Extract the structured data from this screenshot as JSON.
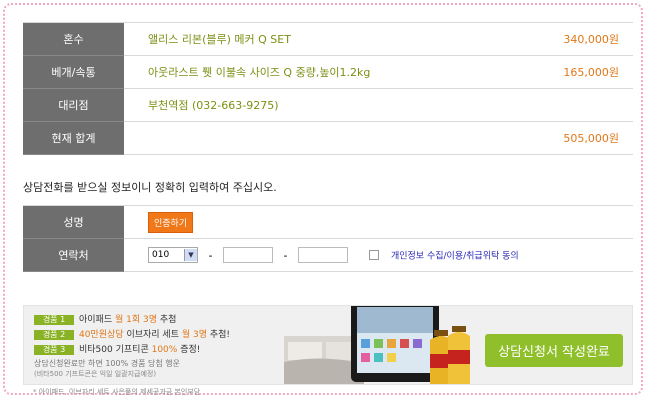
{
  "summary": [
    {
      "label": "혼수",
      "value": "앨리스 리본(블루) 메커 Q SET",
      "price": "340,000원"
    },
    {
      "label": "베개/속통",
      "value": "아웃라스트 퓃 이불속 사이즈 Q 중량,높이1.2kg",
      "price": "165,000원"
    },
    {
      "label": "대리점",
      "value": "부천역점 (032-663-9275)",
      "price": ""
    },
    {
      "label": "현재 합계",
      "value": "",
      "price": "505,000원"
    }
  ],
  "notice": "상담전화를 받으실 정보이니 정확히 입력하여 주십시오.",
  "form": {
    "name_label": "성명",
    "verify_button": "인증하기",
    "phone_label": "연락처",
    "phone_prefix": "010",
    "dash": "-",
    "agree_text": "개인정보 수집/이용/취급위탁 동의"
  },
  "promo": {
    "tag1": "경품 1",
    "line1_a": "아이패드 ",
    "line1_b": "월 1회 3명",
    "line1_c": " 추첨",
    "tag2": "경품 2",
    "line2_a": "40만원상당",
    "line2_b": " 이브자리 세트 ",
    "line2_c": "월 3명",
    "line2_d": " 추첨!",
    "tag3": "경품 3",
    "line3_a": "비타500 기프티콘 ",
    "line3_b": "100%",
    "line3_c": " 증정!",
    "note1": "상담신청완료만 하면 100% 경품 당첨 행운",
    "note2": "(비타500 기프트콘은 익일 일괄지급예정)",
    "footnote": "* 아이패드, 이브자리 세트 사은품의 제세공과금 본인부담",
    "submit": "상담신청서 작성완료"
  },
  "colors": {
    "label_bg": "#6e6e6e",
    "value_text": "#7e8f14",
    "price_text": "#e0781a",
    "accent_green": "#8fbf2a",
    "verify_orange": "#f07819"
  }
}
